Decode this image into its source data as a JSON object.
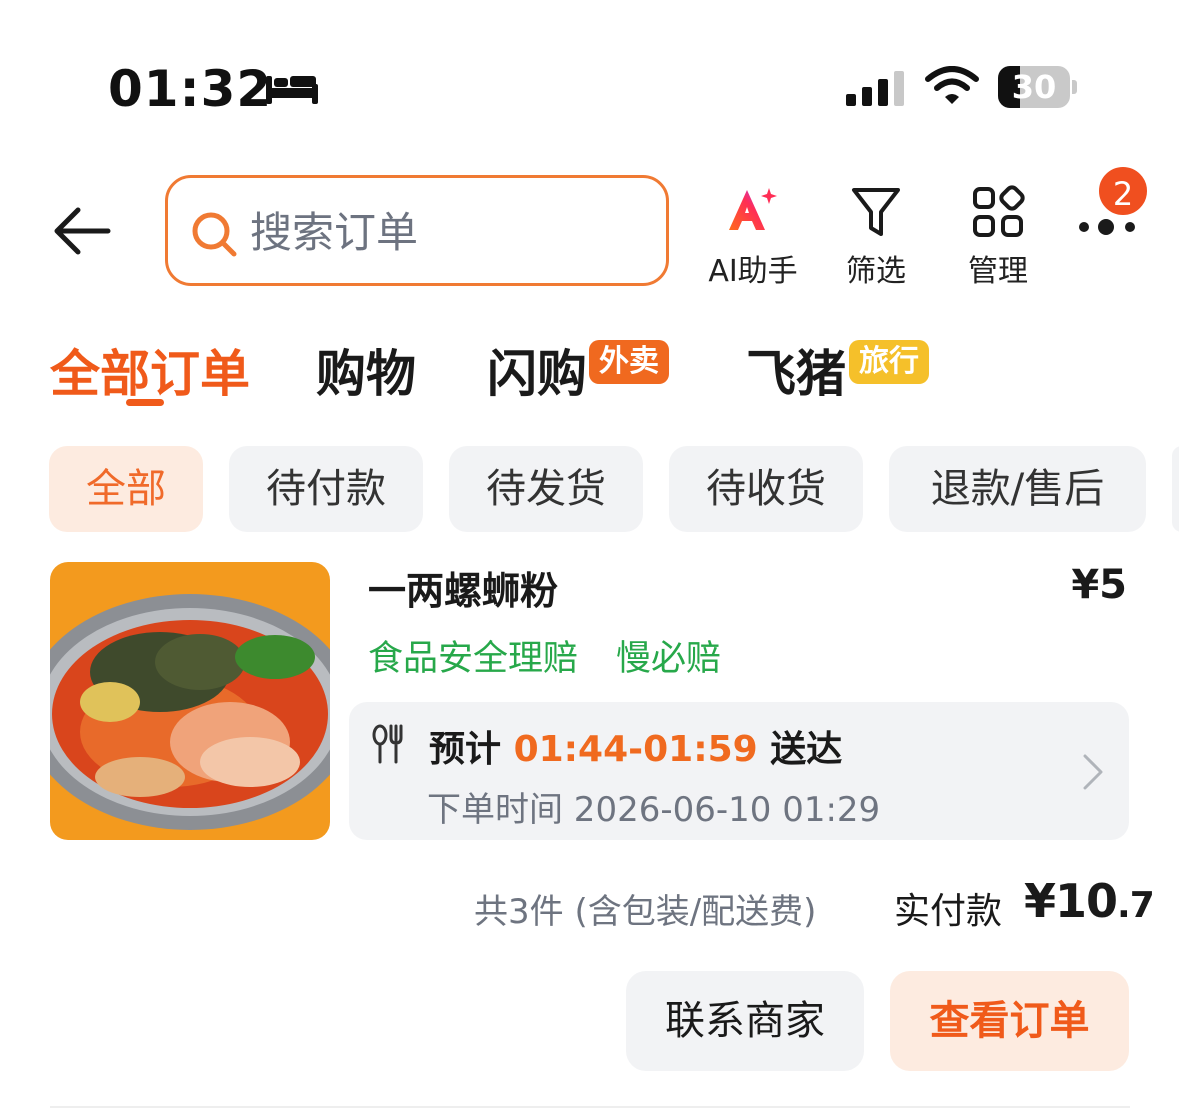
{
  "status_bar": {
    "time": "01:32",
    "battery": "30",
    "battery_level": 0.3
  },
  "search": {
    "placeholder": "搜索订单"
  },
  "toolbar": {
    "ai_label": "AI助手",
    "filter_label": "筛选",
    "manage_label": "管理",
    "more_badge": "2"
  },
  "main_tabs": [
    {
      "label": "全部订单",
      "active": true
    },
    {
      "label": "购物"
    },
    {
      "label": "闪购",
      "tag": "外卖"
    },
    {
      "label": "飞猪",
      "tag": "旅行"
    }
  ],
  "filter_chips": [
    {
      "label": "全部",
      "active": true
    },
    {
      "label": "待付款"
    },
    {
      "label": "待发货"
    },
    {
      "label": "待收货"
    },
    {
      "label": "退款/售后"
    }
  ],
  "order": {
    "item_name": "一两螺蛳粉",
    "price": "¥5",
    "guarantees": [
      "食品安全理赔",
      "慢必赔"
    ],
    "eta_prefix": "预计",
    "eta_time": "01:44-01:59",
    "eta_suffix": "送达",
    "order_time": "下单时间 2026-06-10 01:29",
    "summary": "共3件 (含包装/配送费)",
    "paid_label": "实付款",
    "paid_main": "¥10",
    "paid_small": ".7",
    "buttons": {
      "contact": "联系商家",
      "view": "查看订单"
    }
  },
  "colors": {
    "accent": "#f05a1a",
    "green": "#27a84a",
    "travel_tag": "#f5c02a"
  }
}
